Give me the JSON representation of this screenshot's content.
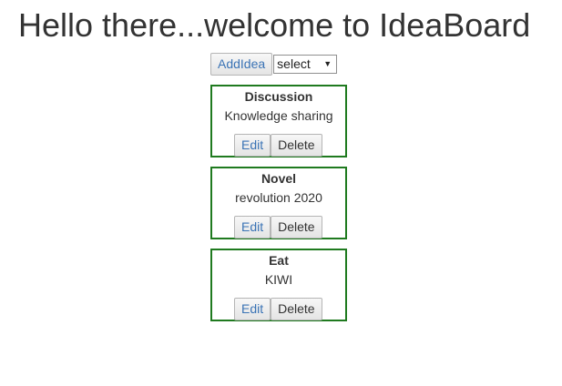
{
  "header": {
    "title": "Hello there...welcome to IdeaBoard"
  },
  "toolbar": {
    "add_label": "AddIdea",
    "select_value": "select"
  },
  "ideas": [
    {
      "name": "Discussion",
      "description": "Knowledge sharing",
      "edit_label": "Edit",
      "delete_label": "Delete"
    },
    {
      "name": "Novel",
      "description": "revolution 2020",
      "edit_label": "Edit",
      "delete_label": "Delete"
    },
    {
      "name": "Eat",
      "description": "KIWI",
      "edit_label": "Edit",
      "delete_label": "Delete"
    }
  ],
  "colors": {
    "card_border": "#1f7a1f",
    "link_text": "#3a73b5"
  }
}
